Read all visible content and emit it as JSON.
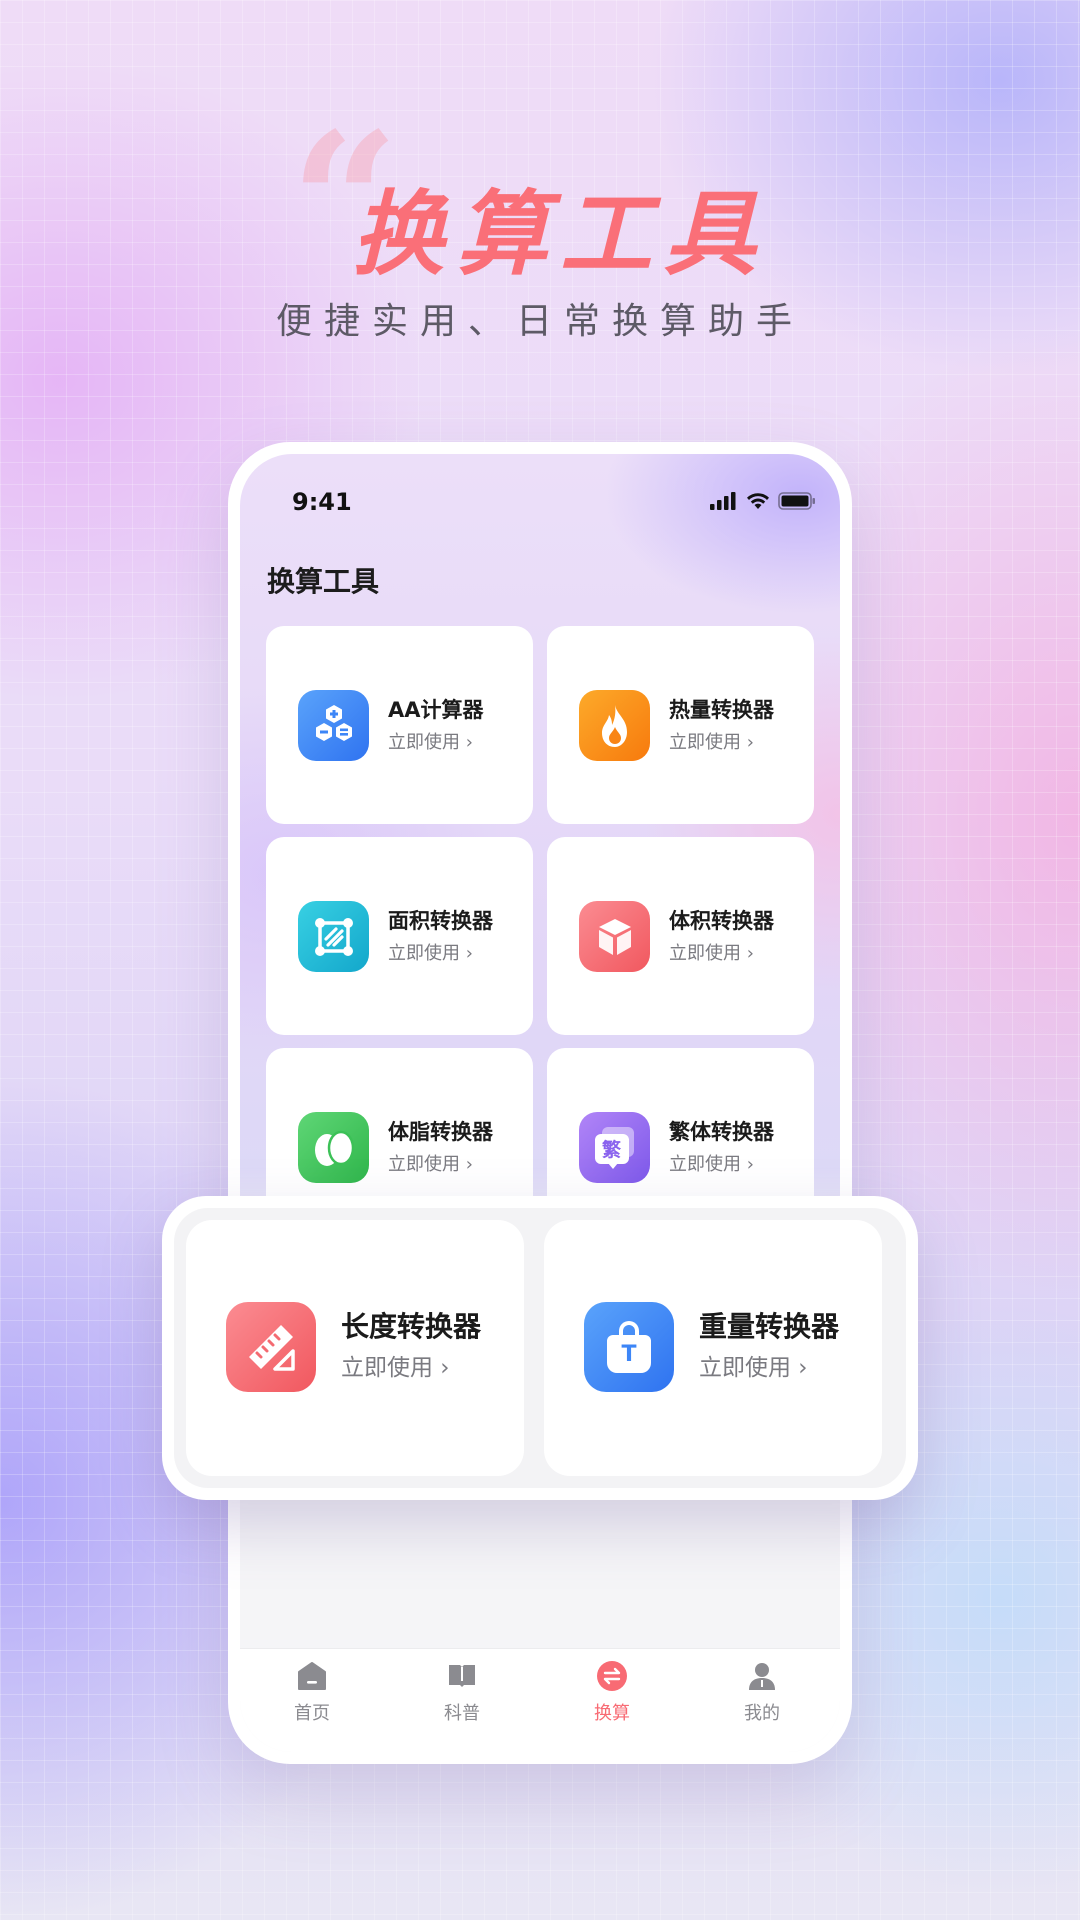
{
  "hero": {
    "quote_mark": "“",
    "title": "换算工具",
    "subtitle": "便捷实用、日常换算助手"
  },
  "status_bar": {
    "time": "9:41"
  },
  "screen": {
    "title": "换算工具"
  },
  "tools": [
    {
      "name": "AA计算器",
      "action": "立即使用 ›",
      "icon": "hexagon-calculator-icon",
      "color": "#3d86f7"
    },
    {
      "name": "热量转换器",
      "action": "立即使用 ›",
      "icon": "flame-icon",
      "color": "#fb8b17"
    },
    {
      "name": "面积转换器",
      "action": "立即使用 ›",
      "icon": "area-frame-icon",
      "color": "#20bcd6"
    },
    {
      "name": "体积转换器",
      "action": "立即使用 ›",
      "icon": "cube-icon",
      "color": "#f7747c"
    },
    {
      "name": "体脂转换器",
      "action": "立即使用 ›",
      "icon": "egg-icon",
      "color": "#40c65a"
    },
    {
      "name": "繁体转换器",
      "action": "立即使用 ›",
      "icon": "traditional-chinese-icon",
      "color": "#9a6cf0",
      "glyph": "繁"
    }
  ],
  "featured": [
    {
      "name": "长度转换器",
      "action": "立即使用 ›",
      "icon": "ruler-icon",
      "color": "#f7737b"
    },
    {
      "name": "重量转换器",
      "action": "立即使用 ›",
      "icon": "weight-icon",
      "color": "#3d86f7",
      "glyph": "T"
    }
  ],
  "tabbar": {
    "items": [
      {
        "label": "首页",
        "icon": "home-icon"
      },
      {
        "label": "科普",
        "icon": "book-icon"
      },
      {
        "label": "换算",
        "icon": "convert-icon",
        "active": true
      },
      {
        "label": "我的",
        "icon": "user-icon"
      }
    ]
  },
  "colors": {
    "accent": "#fa6f78",
    "tab_inactive": "#8b8b90"
  }
}
